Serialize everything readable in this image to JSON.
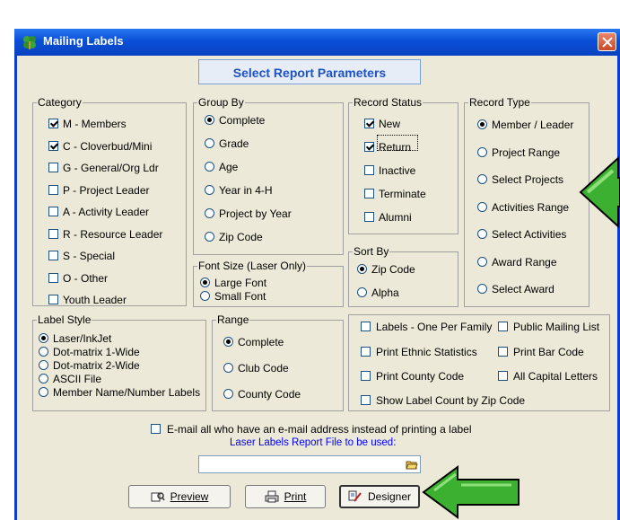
{
  "window": {
    "title": "Mailing Labels"
  },
  "header": {
    "title": "Select Report Parameters"
  },
  "category": {
    "label": "Category",
    "items": [
      {
        "label": "M - Members",
        "checked": true
      },
      {
        "label": "C - Cloverbud/Mini",
        "checked": true
      },
      {
        "label": "G - General/Org Ldr",
        "checked": false
      },
      {
        "label": "P - Project Leader",
        "checked": false
      },
      {
        "label": "A - Activity Leader",
        "checked": false
      },
      {
        "label": "R - Resource Leader",
        "checked": false
      },
      {
        "label": "S - Special",
        "checked": false
      },
      {
        "label": "O - Other",
        "checked": false
      },
      {
        "label": "Youth Leader",
        "checked": false
      }
    ]
  },
  "group_by": {
    "label": "Group By",
    "items": [
      {
        "label": "Complete",
        "selected": true
      },
      {
        "label": "Grade",
        "selected": false
      },
      {
        "label": "Age",
        "selected": false
      },
      {
        "label": "Year in 4-H",
        "selected": false
      },
      {
        "label": "Project by Year",
        "selected": false
      },
      {
        "label": "Zip Code",
        "selected": false
      }
    ]
  },
  "record_status": {
    "label": "Record Status",
    "items": [
      {
        "label": "New",
        "checked": true
      },
      {
        "label": "Return",
        "checked": true
      },
      {
        "label": "Inactive",
        "checked": false
      },
      {
        "label": "Terminate",
        "checked": false
      },
      {
        "label": "Alumni",
        "checked": false
      }
    ]
  },
  "record_type": {
    "label": "Record Type",
    "items": [
      {
        "label": "Member / Leader",
        "selected": true
      },
      {
        "label": "Project Range",
        "selected": false
      },
      {
        "label": "Select Projects",
        "selected": false
      },
      {
        "label": "Activities Range",
        "selected": false
      },
      {
        "label": "Select Activities",
        "selected": false
      },
      {
        "label": "Award Range",
        "selected": false
      },
      {
        "label": "Select Award",
        "selected": false
      }
    ]
  },
  "font_size": {
    "label": "Font Size (Laser Only)",
    "items": [
      {
        "label": "Large Font",
        "selected": true
      },
      {
        "label": "Small Font",
        "selected": false
      }
    ]
  },
  "sort_by": {
    "label": "Sort By",
    "items": [
      {
        "label": "Zip Code",
        "selected": true
      },
      {
        "label": "Alpha",
        "selected": false
      }
    ]
  },
  "label_style": {
    "label": "Label Style",
    "items": [
      {
        "label": "Laser/InkJet",
        "selected": true
      },
      {
        "label": "Dot-matrix 1-Wide",
        "selected": false
      },
      {
        "label": "Dot-matrix 2-Wide",
        "selected": false
      },
      {
        "label": "ASCII File",
        "selected": false
      },
      {
        "label": "Member Name/Number Labels",
        "selected": false
      }
    ]
  },
  "range": {
    "label": "Range",
    "items": [
      {
        "label": "Complete",
        "selected": true
      },
      {
        "label": "Club Code",
        "selected": false
      },
      {
        "label": "County Code",
        "selected": false
      }
    ]
  },
  "options": {
    "items": [
      {
        "label": "Labels - One Per Family",
        "checked": false
      },
      {
        "label": "Public Mailing List",
        "checked": false
      },
      {
        "label": "Print Ethnic Statistics",
        "checked": false
      },
      {
        "label": "Print Bar Code",
        "checked": false
      },
      {
        "label": "Print County Code",
        "checked": false
      },
      {
        "label": "All Capital Letters",
        "checked": false
      },
      {
        "label": "Show Label Count by Zip Code",
        "checked": false
      }
    ]
  },
  "email": {
    "label": "E-mail all who have an e-mail address instead of printing a label",
    "checked": false
  },
  "report_file": {
    "label": "Laser Labels Report File to be used:",
    "value": ""
  },
  "buttons": {
    "preview": "Preview",
    "print": "Print",
    "designer": "Designer"
  },
  "colors": {
    "titlebar": "#0a4fd8",
    "dialog": "#ece9d8",
    "header_text": "#1f53c0",
    "arrow": "#3cb031",
    "link_text": "#0000ff"
  }
}
